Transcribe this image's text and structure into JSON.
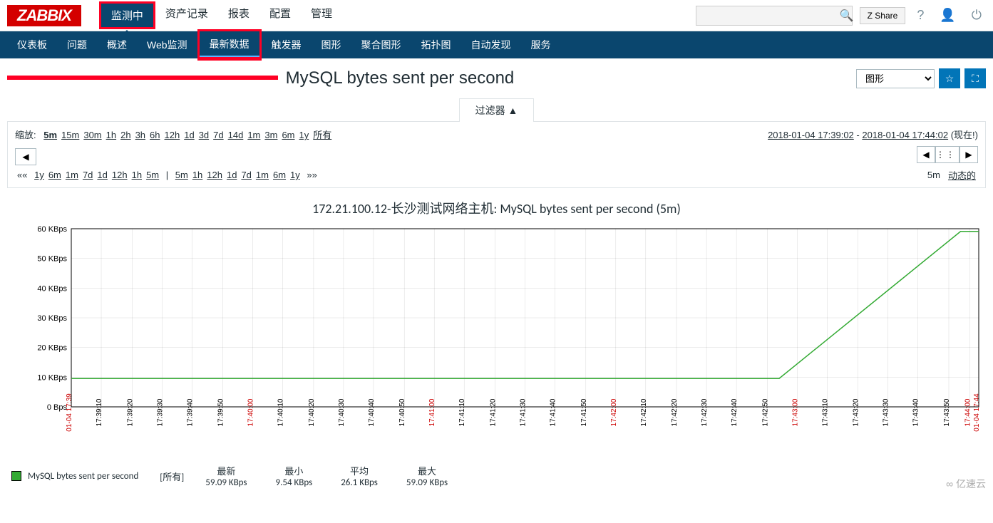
{
  "logo": "ZABBIX",
  "topNav": {
    "items": [
      {
        "label": "监测中",
        "active": true
      },
      {
        "label": "资产记录"
      },
      {
        "label": "报表"
      },
      {
        "label": "配置"
      },
      {
        "label": "管理"
      }
    ]
  },
  "header": {
    "searchPlaceholder": "",
    "shareLabel": "Z Share"
  },
  "subNav": {
    "items": [
      {
        "label": "仪表板"
      },
      {
        "label": "问题"
      },
      {
        "label": "概述"
      },
      {
        "label": "Web监测"
      },
      {
        "label": "最新数据",
        "active": true
      },
      {
        "label": "触发器"
      },
      {
        "label": "图形"
      },
      {
        "label": "聚合图形"
      },
      {
        "label": "拓扑图"
      },
      {
        "label": "自动发现"
      },
      {
        "label": "服务"
      }
    ]
  },
  "page": {
    "titleHost": "172.21.100.12-长沙测试网络主机:",
    "titleMetric": " MySQL bytes sent per second",
    "viewSelect": "图形"
  },
  "filter": {
    "label": "过滤器 ▲"
  },
  "zoom": {
    "label": "缩放:",
    "options": [
      "5m",
      "15m",
      "30m",
      "1h",
      "2h",
      "3h",
      "6h",
      "12h",
      "1d",
      "3d",
      "7d",
      "14d",
      "1m",
      "3m",
      "6m",
      "1y",
      "所有"
    ],
    "activeOption": "5m",
    "timeFrom": "2018-01-04 17:39:02",
    "timeTo": "2018-01-04 17:44:02",
    "nowLabel": "(现在!)",
    "row2Left": [
      "1y",
      "6m",
      "1m",
      "7d",
      "1d",
      "12h",
      "1h",
      "5m"
    ],
    "row2Right": [
      "5m",
      "1h",
      "12h",
      "1d",
      "7d",
      "1m",
      "6m",
      "1y"
    ],
    "row2PrefixL": "««",
    "row2PrefixR": "»»",
    "statusTime": "5m",
    "statusMode": "动态的"
  },
  "chart_data": {
    "type": "line",
    "title": "172.21.100.12-长沙测试网络主机: MySQL bytes sent per second (5m)",
    "ylabel": "KBps",
    "ylim": [
      0,
      60
    ],
    "yticks": [
      {
        "v": 0,
        "label": "0 Bps"
      },
      {
        "v": 10,
        "label": "10 KBps"
      },
      {
        "v": 20,
        "label": "20 KBps"
      },
      {
        "v": 30,
        "label": "30 KBps"
      },
      {
        "v": 40,
        "label": "40 KBps"
      },
      {
        "v": 50,
        "label": "50 KBps"
      },
      {
        "v": 60,
        "label": "60 KBps"
      }
    ],
    "xticks": [
      {
        "pos": 0,
        "label": "01-04 17:39",
        "major": true
      },
      {
        "pos": 0.033,
        "label": "17:39:10"
      },
      {
        "pos": 0.067,
        "label": "17:39:20"
      },
      {
        "pos": 0.1,
        "label": "17:39:30"
      },
      {
        "pos": 0.133,
        "label": "17:39:40"
      },
      {
        "pos": 0.167,
        "label": "17:39:50"
      },
      {
        "pos": 0.2,
        "label": "17:40:00",
        "major": true
      },
      {
        "pos": 0.233,
        "label": "17:40:10"
      },
      {
        "pos": 0.267,
        "label": "17:40:20"
      },
      {
        "pos": 0.3,
        "label": "17:40:30"
      },
      {
        "pos": 0.333,
        "label": "17:40:40"
      },
      {
        "pos": 0.367,
        "label": "17:40:50"
      },
      {
        "pos": 0.4,
        "label": "17:41:00",
        "major": true
      },
      {
        "pos": 0.433,
        "label": "17:41:10"
      },
      {
        "pos": 0.467,
        "label": "17:41:20"
      },
      {
        "pos": 0.5,
        "label": "17:41:30"
      },
      {
        "pos": 0.533,
        "label": "17:41:40"
      },
      {
        "pos": 0.567,
        "label": "17:41:50"
      },
      {
        "pos": 0.6,
        "label": "17:42:00",
        "major": true
      },
      {
        "pos": 0.633,
        "label": "17:42:10"
      },
      {
        "pos": 0.667,
        "label": "17:42:20"
      },
      {
        "pos": 0.7,
        "label": "17:42:30"
      },
      {
        "pos": 0.733,
        "label": "17:42:40"
      },
      {
        "pos": 0.767,
        "label": "17:42:50"
      },
      {
        "pos": 0.8,
        "label": "17:43:00",
        "major": true
      },
      {
        "pos": 0.833,
        "label": "17:43:10"
      },
      {
        "pos": 0.867,
        "label": "17:43:20"
      },
      {
        "pos": 0.9,
        "label": "17:43:30"
      },
      {
        "pos": 0.933,
        "label": "17:43:40"
      },
      {
        "pos": 0.967,
        "label": "17:43:50"
      },
      {
        "pos": 0.99,
        "label": "17:44:00",
        "major": true
      },
      {
        "pos": 1.0,
        "label": "01-04 17:44",
        "major": true
      }
    ],
    "series": [
      {
        "name": "MySQL bytes sent per second",
        "color": "#33aa33",
        "points": [
          {
            "x": 0.0,
            "y": 9.54
          },
          {
            "x": 0.78,
            "y": 9.54
          },
          {
            "x": 0.98,
            "y": 59.09
          },
          {
            "x": 1.0,
            "y": 59.09
          }
        ]
      }
    ]
  },
  "legend": {
    "seriesName": "MySQL bytes sent per second",
    "scope": "[所有]",
    "stats": [
      {
        "label": "最新",
        "value": "59.09 KBps"
      },
      {
        "label": "最小",
        "value": "9.54 KBps"
      },
      {
        "label": "平均",
        "value": "26.1 KBps"
      },
      {
        "label": "最大",
        "value": "59.09 KBps"
      }
    ]
  },
  "watermark": "亿速云"
}
